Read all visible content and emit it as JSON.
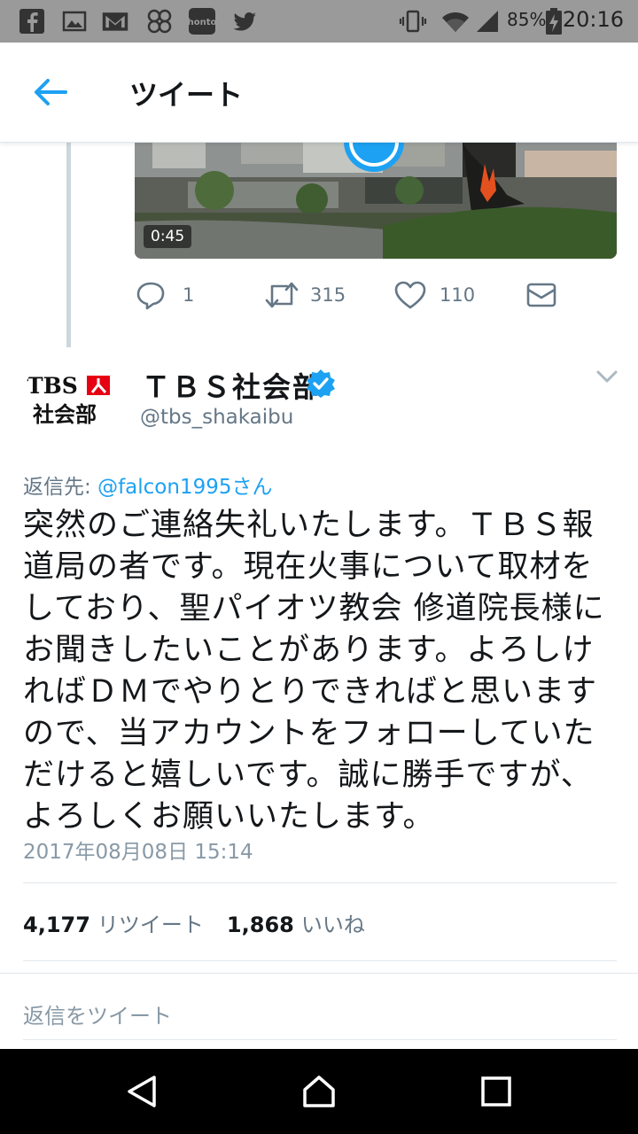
{
  "status_bar": {
    "battery": "85%",
    "time": "20:16"
  },
  "app_bar": {
    "title": "ツイート"
  },
  "previous_tweet": {
    "video_duration": "0:45",
    "reply_count": "1",
    "retweet_count": "315",
    "like_count": "110"
  },
  "tweet": {
    "author_name": "ＴＢＳ社会部",
    "author_handle": "@tbs_shakaibu",
    "avatar_logo_text": "TBS社会部",
    "replying_label": "返信先: ",
    "replying_to": "@falcon1995さん",
    "text": "突然のご連絡失礼いたします。ＴＢＳ報道局の者です。現在火事について取材をしており、聖パイオツ教会 修道院長様にお聞きしたいことがあります。よろしければＤＭでやりとりできればと思いますので、当アカウントをフォローしていただけると嬉しいです。誠に勝手ですが、よろしくお願いいたします。",
    "timestamp": "2017年08月08日 15:14",
    "retweet_count": "4,177",
    "retweet_label": "リツイート",
    "like_count": "1,868",
    "like_label": "いいね"
  },
  "reply_bar": {
    "placeholder": "返信をツイート"
  },
  "colors": {
    "accent": "#1da1f2",
    "secondary_text": "#657786",
    "status_bar": "#9a9a9a",
    "avatar_red": "#e60012"
  }
}
